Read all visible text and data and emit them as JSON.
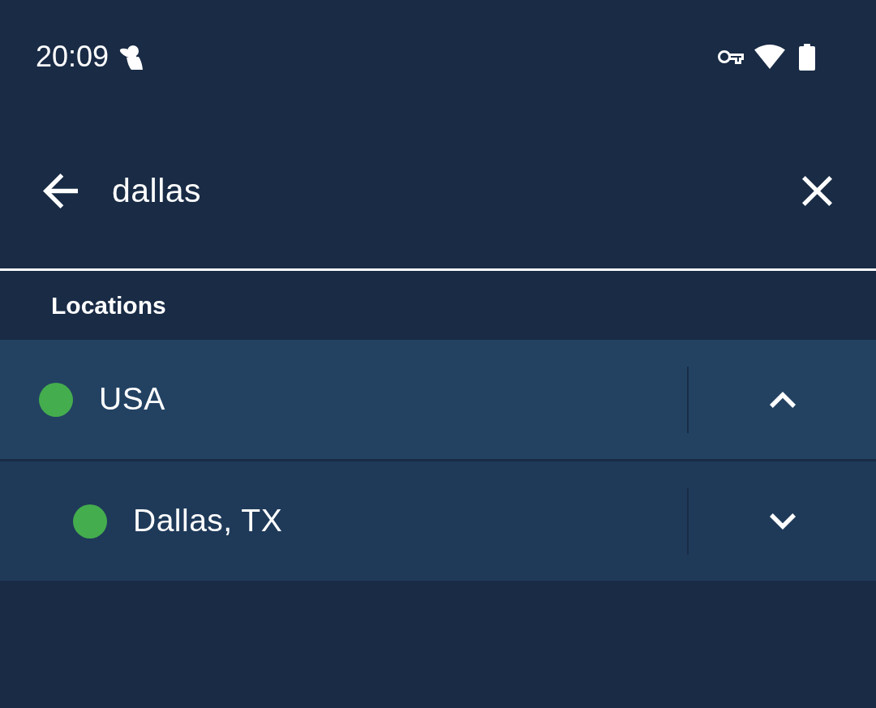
{
  "status_bar": {
    "time": "20:09"
  },
  "search": {
    "value": "dallas"
  },
  "section": {
    "title": "Locations"
  },
  "locations": [
    {
      "name": "USA",
      "color": "#44ad4d",
      "expanded": true,
      "children": [
        {
          "name": "Dallas, TX",
          "color": "#44ad4d",
          "expanded": false
        }
      ]
    }
  ]
}
